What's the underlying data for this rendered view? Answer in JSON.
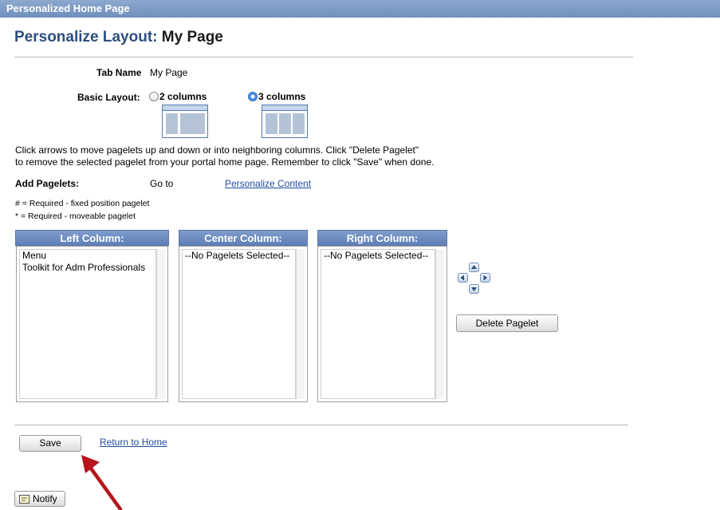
{
  "header": {
    "app_title": "Personalized Home Page"
  },
  "page": {
    "title_prefix": "Personalize Layout:",
    "title_page": "My Page"
  },
  "tab_name": {
    "label": "Tab Name",
    "value": "My Page"
  },
  "basic_layout": {
    "label": "Basic Layout:",
    "options": [
      {
        "label": "2 columns",
        "selected": false
      },
      {
        "label": "3 columns",
        "selected": true
      }
    ]
  },
  "instructions": {
    "line1": "Click arrows to move pagelets up and down or into neighboring columns. Click \"Delete Pagelet\"",
    "line2": "to remove the selected pagelet from your portal home page. Remember to click \"Save\" when done."
  },
  "add_pagelets": {
    "label": "Add Pagelets:",
    "goto": "Go to",
    "link": "Personalize Content"
  },
  "legend": {
    "fixed": "# = Required - fixed position pagelet",
    "moveable": "* = Required - moveable pagelet"
  },
  "columns": {
    "left": {
      "header": "Left Column:",
      "items": [
        "Menu",
        "Toolkit for Adm Professionals"
      ]
    },
    "center": {
      "header": "Center Column:",
      "items": [
        "--No Pagelets Selected--"
      ]
    },
    "right": {
      "header": "Right Column:",
      "items": [
        "--No Pagelets Selected--"
      ]
    }
  },
  "actions": {
    "delete_label": "Delete Pagelet",
    "save_label": "Save",
    "return_link": "Return to Home",
    "notify_label": "Notify"
  },
  "icons": {
    "move_up": "arrow-up-icon",
    "move_left": "arrow-left-icon",
    "move_right": "arrow-right-icon",
    "move_down": "arrow-down-icon",
    "notify": "notify-icon",
    "annotation": "red-arrow-icon"
  },
  "colors": {
    "accent": "#2d4f7f",
    "header_bar": "#6f8fbc",
    "link": "#1f4ea3",
    "annotation": "#b5151b"
  }
}
